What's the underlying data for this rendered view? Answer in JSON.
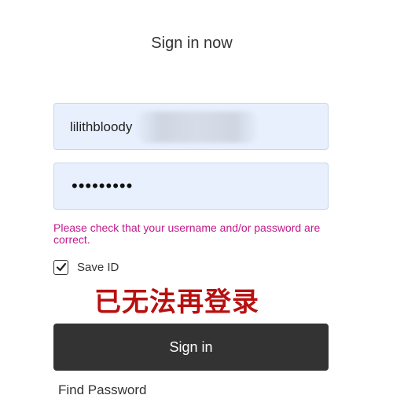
{
  "header": {
    "title": "Sign in now"
  },
  "form": {
    "username_value": "lilithbloody",
    "password_masked": "•••••••••",
    "error_message": "Please check that your username and/or password are correct.",
    "save_id_label": "Save ID",
    "save_id_checked": true,
    "submit_label": "Sign in",
    "find_password_label": "Find Password"
  },
  "overlay": {
    "caption": "已无法再登录"
  },
  "colors": {
    "field_background": "#e8f0fe",
    "error_text": "#c2188b",
    "button_background": "#333333",
    "overlay_caption": "#b81010"
  },
  "icons": {
    "checkbox": "checkmark-icon"
  }
}
